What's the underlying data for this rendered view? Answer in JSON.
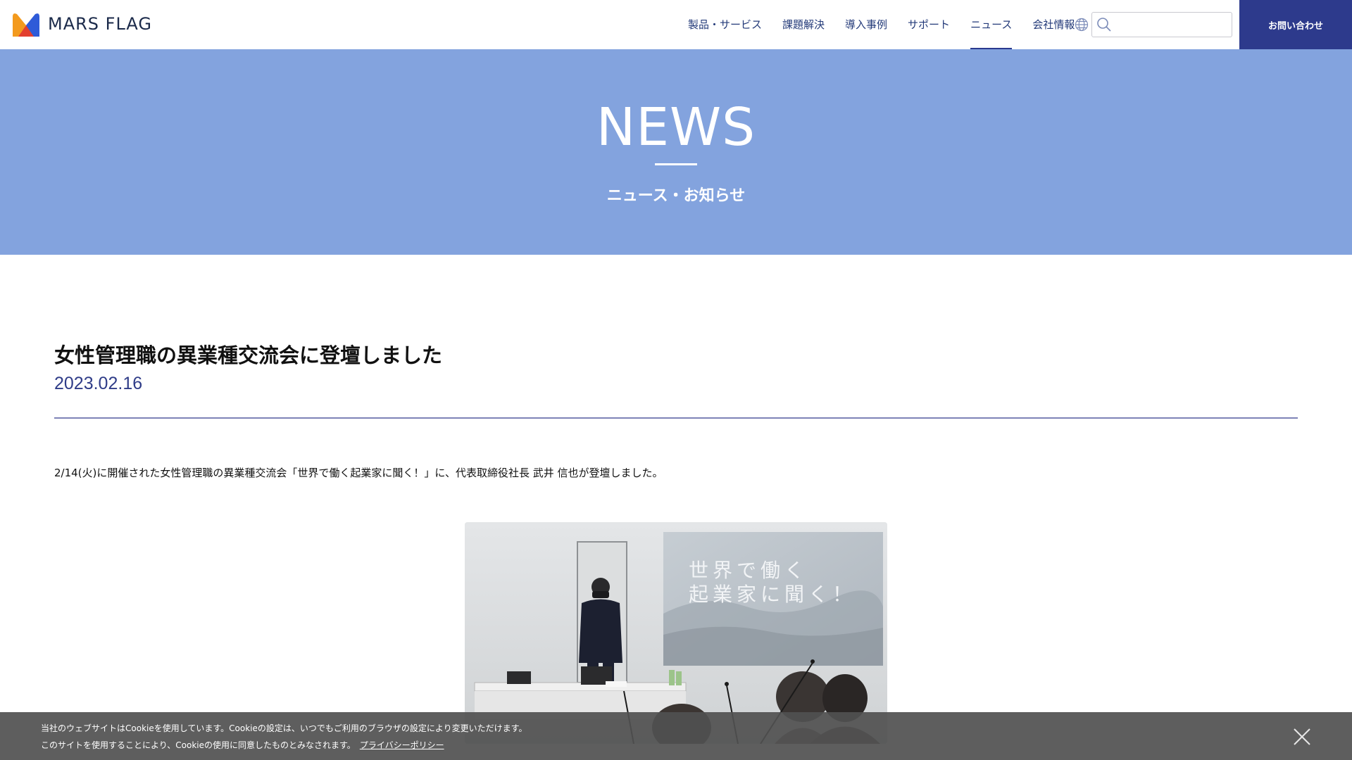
{
  "brand": {
    "name": "MARS FLAG",
    "colors": {
      "primary": "#2d3a8c",
      "hero_bg": "#83a3de",
      "logo_orange": "#f39a1e",
      "logo_red": "#e2402f",
      "logo_blue": "#2f5bd8"
    }
  },
  "nav": {
    "items": [
      {
        "label": "製品・サービス"
      },
      {
        "label": "課題解決"
      },
      {
        "label": "導入事例"
      },
      {
        "label": "サポート"
      },
      {
        "label": "ニュース",
        "active": true
      },
      {
        "label": "会社情報"
      }
    ],
    "globe_icon": "globe-icon",
    "search": {
      "value": "",
      "placeholder": "",
      "icon": "search-icon"
    },
    "contact_label": "お問い合わせ"
  },
  "hero": {
    "title": "NEWS",
    "subtitle": "ニュース・お知らせ"
  },
  "article": {
    "title": "女性管理職の異業種交流会に登壇しました",
    "date": "2023.02.16",
    "body": "2/14(火)に開催された女性管理職の異業種交流会「世界で働く起業家に聞く！」に、代表取締役社長 武井 信也が登壇しました。",
    "photo": {
      "slide_line1": "世界で働く",
      "slide_line2": "起業家に聞く！"
    }
  },
  "cookie": {
    "line1": "当社のウェブサイトはCookieを使用しています。Cookieの設定は、いつでもご利用のブラウザの設定により変更いただけます。",
    "line2": "このサイトを使用することにより、Cookieの使用に同意したものとみなされます。",
    "link_label": "プライバシーポリシー",
    "close_icon": "close-icon"
  }
}
